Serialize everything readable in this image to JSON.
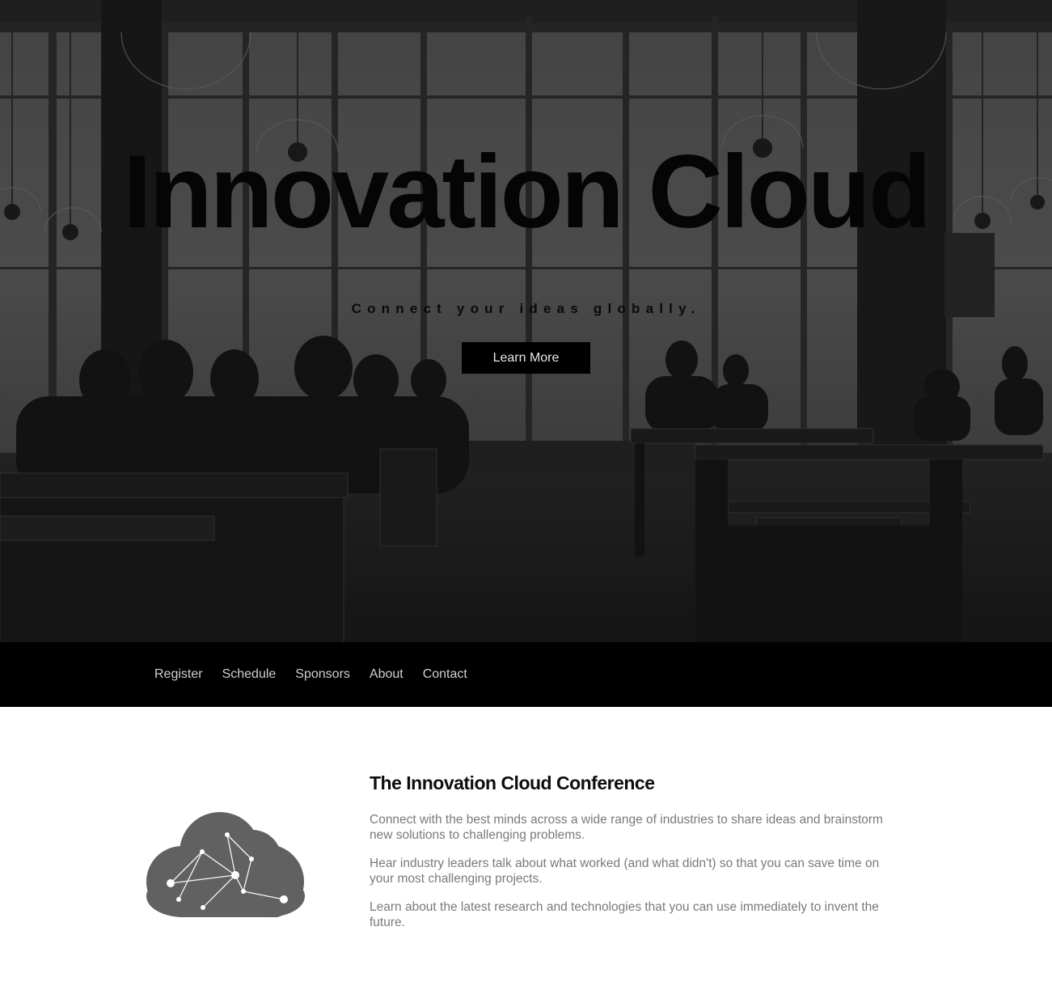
{
  "hero": {
    "title": "Innovation Cloud",
    "subtitle": "Connect your ideas globally.",
    "button_label": "Learn More"
  },
  "nav": {
    "items": [
      {
        "label": "Register"
      },
      {
        "label": "Schedule"
      },
      {
        "label": "Sponsors"
      },
      {
        "label": "About"
      },
      {
        "label": "Contact"
      }
    ]
  },
  "about": {
    "heading": "The Innovation Cloud Conference",
    "paragraphs": [
      "Connect with the best minds across a wide range of industries to share ideas and brainstorm new solutions to challenging problems.",
      "Hear industry leaders talk about what worked (and what didn't) so that you can save time on your most challenging projects.",
      "Learn about the latest research and technologies that you can use immediately to invent the future."
    ]
  },
  "colors": {
    "nav_background": "#000000",
    "button_background": "#000000",
    "logo_fill": "#616161"
  }
}
